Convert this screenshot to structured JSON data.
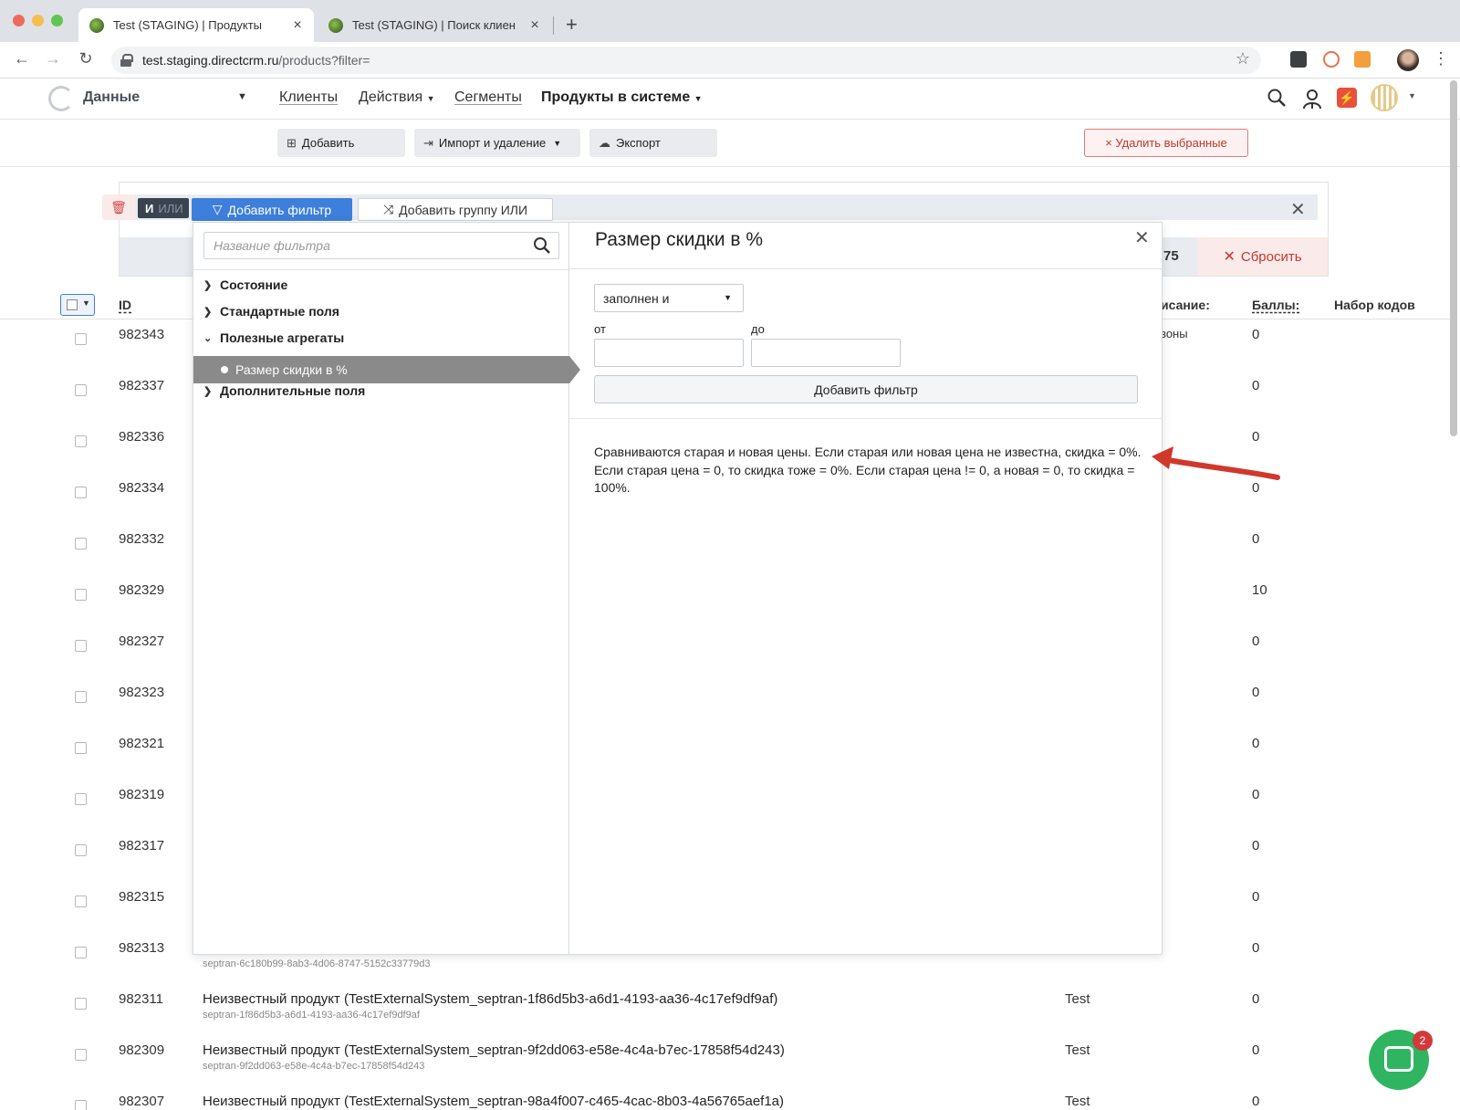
{
  "browser": {
    "tabs": [
      {
        "title": "Test (STAGING) | Продукты",
        "active": true
      },
      {
        "title": "Test (STAGING) | Поиск клиен",
        "active": false
      }
    ],
    "url_host": "test.staging.directcrm.ru",
    "url_path": "/products?filter="
  },
  "header": {
    "brand": "Данные",
    "nav": [
      {
        "label": "Клиенты"
      },
      {
        "label": "Действия"
      },
      {
        "label": "Сегменты"
      },
      {
        "label": "Продукты в системе"
      }
    ]
  },
  "toolbar": {
    "add": "Добавить",
    "import": "Импорт и удаление",
    "export": "Экспорт",
    "delete_selected": "× Удалить выбранные"
  },
  "filter_bar": {
    "and_label": "И",
    "or_label": "ИЛИ",
    "add_filter": "Добавить фильтр",
    "add_group": "Добавить группу ИЛИ",
    "count_fragment": "75",
    "reset": "Сбросить"
  },
  "table": {
    "headers": {
      "id": "ID",
      "description_fragment": "исание:",
      "points": "Баллы:",
      "codes": "Набор кодов"
    },
    "rows": [
      {
        "id": "982343",
        "points": "0",
        "cat2": "зоны"
      },
      {
        "id": "982337",
        "points": "0"
      },
      {
        "id": "982336",
        "points": "0"
      },
      {
        "id": "982334",
        "points": "0"
      },
      {
        "id": "982332",
        "points": "0"
      },
      {
        "id": "982329",
        "points": "10"
      },
      {
        "id": "982327",
        "points": "0"
      },
      {
        "id": "982323",
        "points": "0"
      },
      {
        "id": "982321",
        "points": "0"
      },
      {
        "id": "982319",
        "points": "0"
      },
      {
        "id": "982317",
        "points": "0"
      },
      {
        "id": "982315",
        "points": "0"
      },
      {
        "id": "982313",
        "points": "0",
        "sub": "septran-6c180b99-8ab3-4d06-8747-5152c33779d3"
      },
      {
        "id": "982311",
        "points": "0",
        "name": "Неизвестный продукт (TestExternalSystem_septran-1f86d5b3-a6d1-4193-aa36-4c17ef9df9af)",
        "sub": "septran-1f86d5b3-a6d1-4193-aa36-4c17ef9df9af",
        "cat": "Test"
      },
      {
        "id": "982309",
        "points": "0",
        "name": "Неизвестный продукт (TestExternalSystem_septran-9f2dd063-e58e-4c4a-b7ec-17858f54d243)",
        "sub": "septran-9f2dd063-e58e-4c4a-b7ec-17858f54d243",
        "cat": "Test"
      },
      {
        "id": "982307",
        "points": "0",
        "name": "Неизвестный продукт (TestExternalSystem_septran-98a4f007-c465-4cac-8b03-4a56765aef1a)",
        "cat": "Test"
      }
    ]
  },
  "filter_popup": {
    "search_placeholder": "Название фильтра",
    "tree": {
      "state": "Состояние",
      "standard": "Стандартные поля",
      "aggregates": "Полезные агрегаты",
      "selected_leaf": "Размер скидки в %",
      "additional": "Дополнительные поля"
    },
    "title": "Размер скидки в %",
    "condition": "заполнен и",
    "from_label": "от",
    "to_label": "до",
    "add_button": "Добавить фильтр",
    "description": "Сравниваются старая и новая цены. Если старая или новая цена не известна, скидка = 0%. Если старая цена = 0, то скидка тоже = 0%. Если старая цена != 0, а новая = 0, то скидка = 100%."
  },
  "chat": {
    "badge": "2"
  },
  "colors": {
    "accent": "#3d7fdb",
    "danger": "#c0392b",
    "chat": "#2fb561",
    "arrow": "#d0382b"
  }
}
